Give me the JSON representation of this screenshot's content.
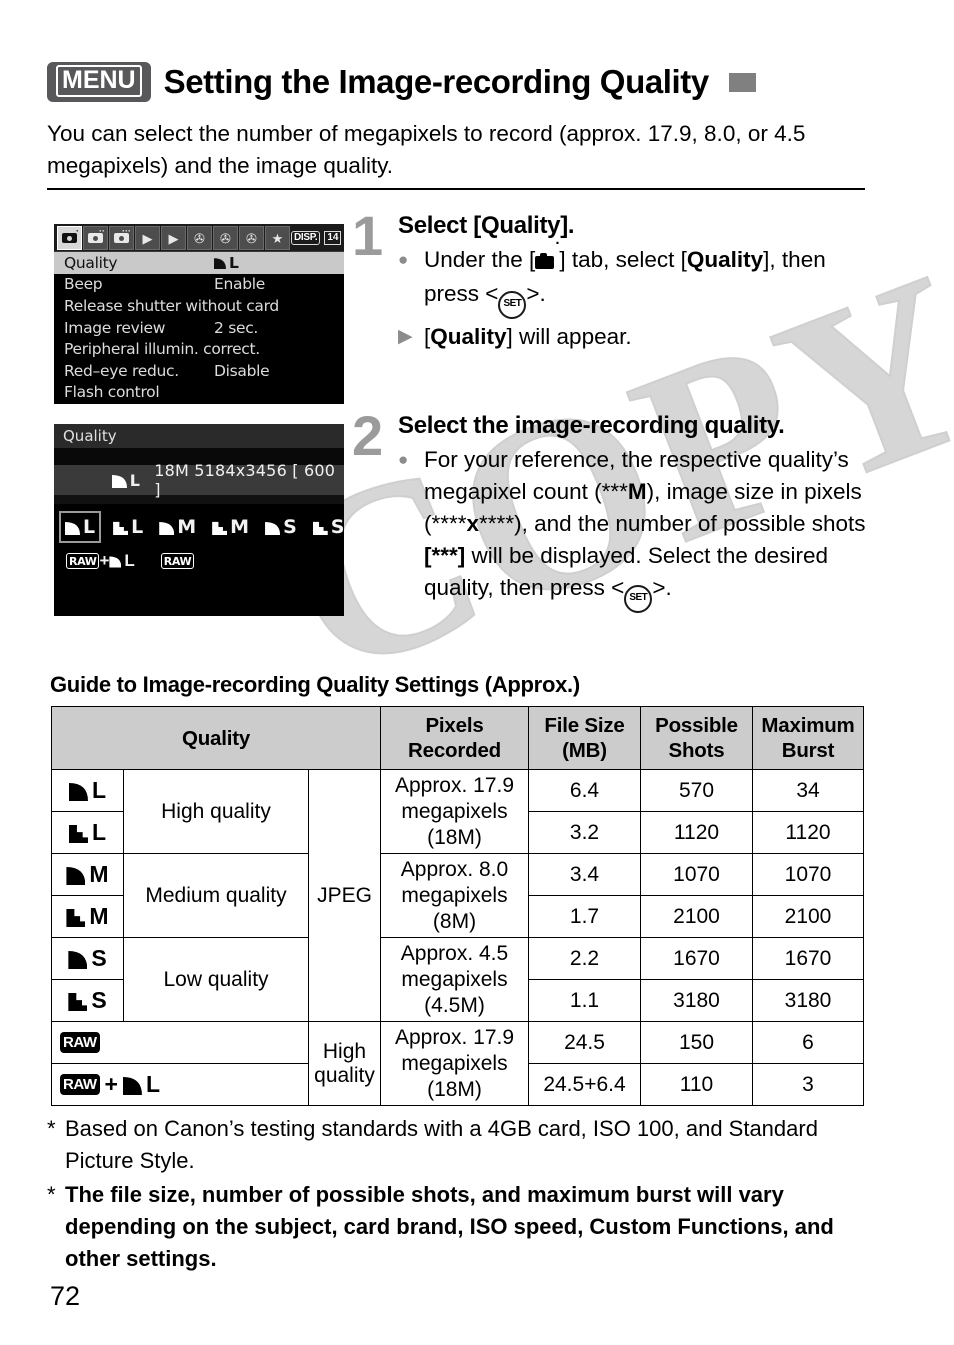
{
  "header": {
    "menu_badge": "MENU",
    "title": "Setting the Image-recording Quality",
    "corner_icon": "gray-square"
  },
  "intro": "You can select the number of megapixels to record (approx. 17.9, 8.0, or 4.5 megapixels) and the image quality.",
  "menu_screen": {
    "disp_badge": "DISP.",
    "battery_badge": "14",
    "tabs": [
      {
        "name": "shooting-tab-1",
        "type": "camera",
        "active": true,
        "sup": "•"
      },
      {
        "name": "shooting-tab-2",
        "type": "camera",
        "active": false,
        "sup": "••"
      },
      {
        "name": "shooting-tab-3",
        "type": "camera",
        "active": false,
        "sup": "•••"
      },
      {
        "name": "playback-tab-1",
        "type": "play",
        "active": false,
        "glyph": "▶"
      },
      {
        "name": "playback-tab-2",
        "type": "play",
        "active": false,
        "glyph": "▶"
      },
      {
        "name": "setup-tab-1",
        "type": "wrench",
        "active": false,
        "glyph": "⚙"
      },
      {
        "name": "setup-tab-2",
        "type": "wrench",
        "active": false,
        "glyph": "⚙"
      },
      {
        "name": "setup-tab-3",
        "type": "wrench",
        "active": false,
        "glyph": "⚙"
      },
      {
        "name": "my-menu-tab",
        "type": "star",
        "active": false,
        "glyph": "★"
      }
    ],
    "rows": [
      {
        "label": "Quality",
        "value": "L",
        "mark": "fine",
        "selected": true
      },
      {
        "label": "Beep",
        "value": "Enable",
        "mark": "",
        "selected": false
      },
      {
        "label": "Release shutter without card",
        "value": "",
        "mark": "",
        "selected": false
      },
      {
        "label": "Image review",
        "value": "2 sec.",
        "mark": "",
        "selected": false
      },
      {
        "label": "Peripheral illumin. correct.",
        "value": "",
        "mark": "",
        "selected": false
      },
      {
        "label": "Red–eye reduc.",
        "value": "Disable",
        "mark": "",
        "selected": false
      },
      {
        "label": "Flash control",
        "value": "",
        "mark": "",
        "selected": false
      }
    ]
  },
  "quality_screen": {
    "title": "Quality",
    "current_mark": "fine",
    "current_letter": "L",
    "info": "18M 5184x3456 [ 600 ]",
    "options": [
      {
        "mark": "fine",
        "letter": "L",
        "selected": true
      },
      {
        "mark": "norm",
        "letter": "L",
        "selected": false
      },
      {
        "mark": "fine",
        "letter": "M",
        "selected": false
      },
      {
        "mark": "norm",
        "letter": "M",
        "selected": false
      },
      {
        "mark": "fine",
        "letter": "S",
        "selected": false
      },
      {
        "mark": "norm",
        "letter": "S",
        "selected": false
      }
    ],
    "raw_options": [
      {
        "badge": "RAW",
        "plus": "+",
        "mark": "fine",
        "letter": "L"
      },
      {
        "badge": "RAW",
        "plus": "",
        "mark": "",
        "letter": ""
      }
    ]
  },
  "steps": [
    {
      "number": "1",
      "heading": "Select [Quality].",
      "bullets": [
        {
          "type": "dot",
          "html": "Under the [<span class=\"camtab-icon\" data-name=\"shooting-tab-icon\" data-interactable=\"false\"><span class=\"body\"></span><span class=\"sup\">·</span></span>] tab, select [<b>Quality</b>], then press &lt;<span class=\"set-icon\" data-name=\"set-button-icon\" data-interactable=\"false\">SET</span>&gt;."
        },
        {
          "type": "triangle",
          "html": "[<b>Quality</b>] will appear."
        }
      ]
    },
    {
      "number": "2",
      "heading": "Select the image-recording quality.",
      "bullets": [
        {
          "type": "dot",
          "html": "For your reference, the respective quality’s megapixel count (***<b>M</b>), image size in pixels (****<b>x</b>****), and the number of possible shots <b>[***]</b> will be displayed. Select the desired quality, then press &lt;<span class=\"set-icon\" data-name=\"set-button-icon\" data-interactable=\"false\">SET</span>&gt;."
        }
      ]
    }
  ],
  "table": {
    "caption": "Guide to Image-recording Quality Settings (Approx.)",
    "headers": {
      "quality": "Quality",
      "pixels": "Pixels Recorded",
      "pixels_l1": "Pixels",
      "pixels_l2": "Recorded",
      "filesize_l1": "File Size",
      "filesize_l2": "(MB)",
      "shots_l1": "Possible",
      "shots_l2": "Shots",
      "burst_l1": "Maximum",
      "burst_l2": "Burst"
    },
    "format_jpeg": "JPEG",
    "groups": [
      {
        "desc": "High quality",
        "pixels_l1": "Approx. 17.9",
        "pixels_l2": "megapixels",
        "pixels_l3": "(18M)"
      },
      {
        "desc": "Medium quality",
        "pixels_l1": "Approx. 8.0",
        "pixels_l2": "megapixels",
        "pixels_l3": "(8M)"
      },
      {
        "desc": "Low quality",
        "pixels_l1": "Approx. 4.5",
        "pixels_l2": "megapixels",
        "pixels_l3": "(4.5M)"
      },
      {
        "desc": "High quality",
        "pixels_l1": "Approx. 17.9",
        "pixels_l2": "megapixels",
        "pixels_l3": "(18M)"
      }
    ],
    "rows": [
      {
        "mark": "fine",
        "letter": "L",
        "badge": "",
        "file_size": "6.4",
        "shots": "570",
        "burst": "34"
      },
      {
        "mark": "norm",
        "letter": "L",
        "badge": "",
        "file_size": "3.2",
        "shots": "1120",
        "burst": "1120"
      },
      {
        "mark": "fine",
        "letter": "M",
        "badge": "",
        "file_size": "3.4",
        "shots": "1070",
        "burst": "1070"
      },
      {
        "mark": "norm",
        "letter": "M",
        "badge": "",
        "file_size": "1.7",
        "shots": "2100",
        "burst": "2100"
      },
      {
        "mark": "fine",
        "letter": "S",
        "badge": "",
        "file_size": "2.2",
        "shots": "1670",
        "burst": "1670"
      },
      {
        "mark": "norm",
        "letter": "S",
        "badge": "",
        "file_size": "1.1",
        "shots": "3180",
        "burst": "3180"
      },
      {
        "mark": "",
        "letter": "",
        "badge": "RAW",
        "file_size": "24.5",
        "shots": "150",
        "burst": "6"
      },
      {
        "mark": "fine",
        "letter": "L",
        "badge": "RAW",
        "plus": "+",
        "file_size": "24.5+6.4",
        "shots": "110",
        "burst": "3"
      }
    ]
  },
  "notes": [
    {
      "star": "*",
      "text": "Based on Canon’s testing standards with a 4GB card, ISO 100, and Standard Picture Style.",
      "bold": false
    },
    {
      "star": "*",
      "text": "The file size, number of possible shots, and maximum burst will vary depending on the subject, card brand, ISO speed, Custom Functions, and other settings.",
      "bold": true
    }
  ],
  "page_number": "72",
  "watermark": "COPY"
}
